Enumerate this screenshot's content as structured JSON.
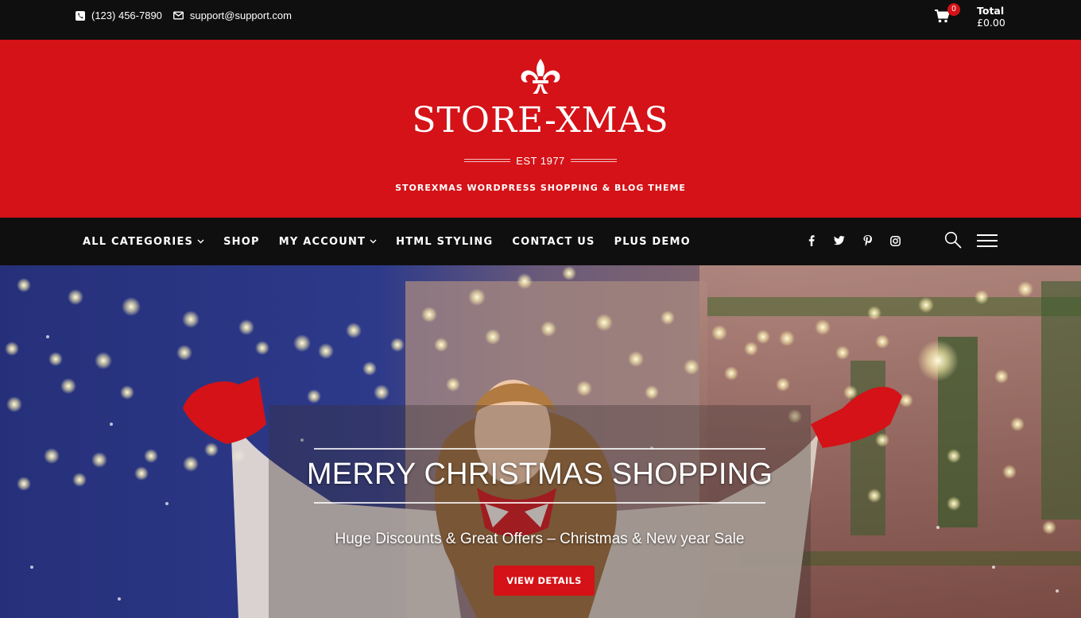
{
  "topbar": {
    "phone": "(123) 456-7890",
    "email": "support@support.com",
    "cart_count": "0",
    "total_label": "Total",
    "total_amount": "£0.00"
  },
  "header": {
    "site_title": "STORE-XMAS",
    "est": "EST 1977",
    "tagline": "STOREXMAS WORDPRESS SHOPPING & BLOG THEME"
  },
  "nav": {
    "items": [
      {
        "label": "ALL CATEGORIES",
        "has_dropdown": true
      },
      {
        "label": "SHOP",
        "has_dropdown": false
      },
      {
        "label": "MY ACCOUNT",
        "has_dropdown": true
      },
      {
        "label": "HTML STYLING",
        "has_dropdown": false
      },
      {
        "label": "CONTACT US",
        "has_dropdown": false
      },
      {
        "label": "PLUS DEMO",
        "has_dropdown": false
      }
    ],
    "social": [
      "facebook-icon",
      "twitter-icon",
      "pinterest-icon",
      "instagram-icon"
    ]
  },
  "hero": {
    "title": "MERRY CHRISTMAS SHOPPING",
    "subtitle": "Huge Discounts & Great Offers – Christmas & New year Sale",
    "button": "VIEW DETAILS"
  },
  "colors": {
    "brand_red": "#d41217",
    "bar_black": "#0f0f0f"
  }
}
